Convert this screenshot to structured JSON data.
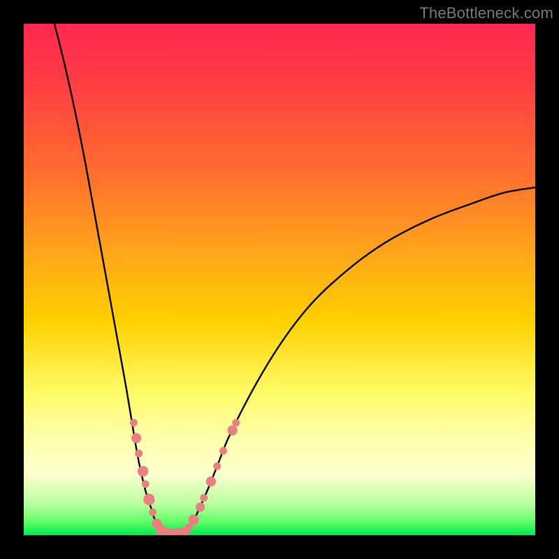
{
  "watermark": "TheBottleneck.com",
  "colors": {
    "frame": "#000000",
    "curve": "#000000",
    "marker_fill": "#e98080",
    "marker_stroke": "#d46a6a"
  },
  "chart_data": {
    "type": "line",
    "title": "",
    "xlabel": "",
    "ylabel": "",
    "xlim": [
      0,
      100
    ],
    "ylim": [
      0,
      100
    ],
    "x_optimum": 26,
    "note": "V-shaped bottleneck curve: y≈0 near x≈26, rising steeply toward both sides; right branch asymptotes near y≈68 at x=100.",
    "left_curve": {
      "x": [
        6,
        8,
        10,
        12,
        14,
        16,
        18,
        20,
        22,
        23,
        24,
        25,
        26,
        27,
        28,
        29,
        30
      ],
      "y": [
        100,
        92,
        83,
        73,
        62,
        51,
        40,
        29,
        17,
        12,
        8,
        5,
        2,
        1,
        0.3,
        0,
        0
      ]
    },
    "right_curve": {
      "x": [
        30,
        31,
        32,
        33,
        34,
        36,
        38,
        40,
        44,
        48,
        52,
        56,
        60,
        66,
        72,
        80,
        88,
        94,
        100
      ],
      "y": [
        0,
        0.3,
        1.2,
        2.5,
        4.5,
        9,
        14,
        19,
        27,
        34,
        40,
        45,
        49,
        54,
        58,
        62,
        65,
        67,
        68
      ]
    },
    "markers": [
      {
        "x": 21.5,
        "y": 22,
        "r": 1.0
      },
      {
        "x": 22.0,
        "y": 19,
        "r": 1.3
      },
      {
        "x": 22.5,
        "y": 16,
        "r": 1.0
      },
      {
        "x": 23.3,
        "y": 12.5,
        "r": 1.4
      },
      {
        "x": 23.8,
        "y": 10,
        "r": 1.0
      },
      {
        "x": 24.5,
        "y": 7,
        "r": 1.5
      },
      {
        "x": 25.2,
        "y": 4.5,
        "r": 1.0
      },
      {
        "x": 26.0,
        "y": 2.3,
        "r": 1.3
      },
      {
        "x": 27.0,
        "y": 0.8,
        "r": 1.6
      },
      {
        "x": 28.5,
        "y": 0.2,
        "r": 1.6
      },
      {
        "x": 30.0,
        "y": 0.2,
        "r": 1.6
      },
      {
        "x": 31.3,
        "y": 0.6,
        "r": 1.4
      },
      {
        "x": 32.3,
        "y": 1.6,
        "r": 1.0
      },
      {
        "x": 33.2,
        "y": 3.0,
        "r": 1.4
      },
      {
        "x": 34.5,
        "y": 5.5,
        "r": 1.2
      },
      {
        "x": 35.2,
        "y": 7.3,
        "r": 1.0
      },
      {
        "x": 36.6,
        "y": 10.5,
        "r": 1.3
      },
      {
        "x": 37.8,
        "y": 13.5,
        "r": 1.0
      },
      {
        "x": 39.0,
        "y": 16.5,
        "r": 1.0
      },
      {
        "x": 40.8,
        "y": 20.5,
        "r": 1.3
      },
      {
        "x": 41.5,
        "y": 22,
        "r": 1.0
      }
    ]
  }
}
